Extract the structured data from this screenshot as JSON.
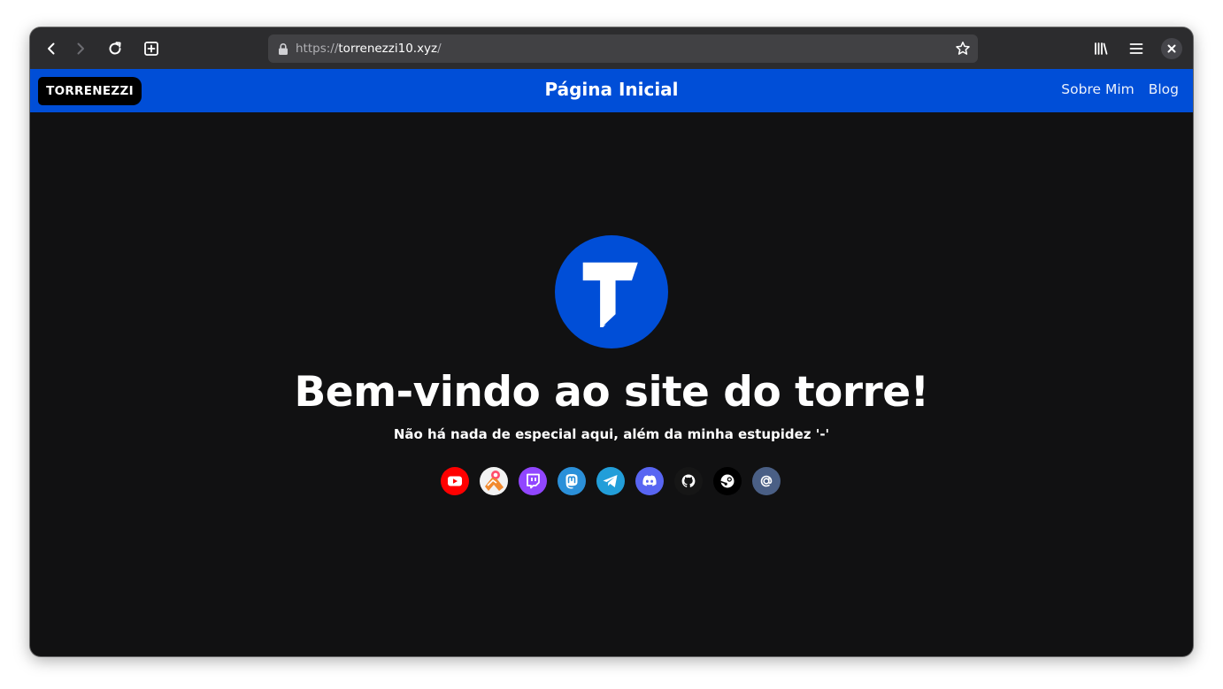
{
  "browser": {
    "url_scheme": "https://",
    "url_host": "torrenezzi10.xyz",
    "url_path": "/"
  },
  "nav": {
    "logo_text": "TORRENEZZI",
    "title": "Página Inicial",
    "links": [
      {
        "label": "Sobre Mim"
      },
      {
        "label": "Blog"
      }
    ]
  },
  "hero": {
    "avatar_letter": "T",
    "title": "Bem-vindo ao site do torre!",
    "subtitle": "Não há nada de especial aqui, além da minha estupidez '-'"
  },
  "socials": [
    {
      "icon": "youtube-icon",
      "color": "#ff0000"
    },
    {
      "icon": "kofi-icon",
      "color": "#f5f5f5"
    },
    {
      "icon": "twitch-icon",
      "color": "#9146ff"
    },
    {
      "icon": "mastodon-icon",
      "color": "#2b90d9"
    },
    {
      "icon": "telegram-icon",
      "color": "#229ed9"
    },
    {
      "icon": "discord-icon",
      "color": "#5865f2"
    },
    {
      "icon": "github-icon",
      "color": "#161616"
    },
    {
      "icon": "steam-icon",
      "color": "#000000"
    },
    {
      "icon": "email-icon",
      "color": "#4a5f85"
    }
  ],
  "colors": {
    "brand_blue": "#004ed7",
    "page_bg": "#111112",
    "toolbar_bg": "#2c2c2e"
  }
}
